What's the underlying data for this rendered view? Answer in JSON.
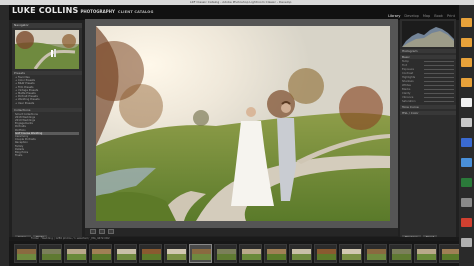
{
  "os": {
    "title_text": "LRF Classic Catalog - Adobe Photoshop Lightroom Classic - Develop"
  },
  "identity": {
    "name": "LUKE COLLINS",
    "studio": "PHOTOGRAPHY",
    "catalog": "CLIENT CATALOG"
  },
  "modules": [
    {
      "label": "Library",
      "active": true
    },
    {
      "label": "Develop",
      "active": false
    },
    {
      "label": "Map",
      "active": false
    },
    {
      "label": "Book",
      "active": false
    },
    {
      "label": "Print",
      "active": false
    }
  ],
  "left": {
    "navigator_label": "Navigator",
    "presets_label": "Presets",
    "collections_label": "Collections",
    "presets": [
      "+ Favorites",
      "+ Color Presets",
      "+ B&W Presets",
      "+ Film Presets",
      "+ Vintage Presets",
      "+ Matte Presets",
      "+ Portrait Presets",
      "+ Wedding Presets",
      "+ User Presets"
    ],
    "collections": [
      "Smart Collections",
      "2018 Weddings",
      "2019 Weddings",
      "Engagements",
      "Portraits",
      "Portfolio",
      "Golf Course Wedding",
      "Ceremony",
      "Couple Portraits",
      "Reception",
      "Family",
      "Details",
      "Blog Picks",
      "Finals"
    ],
    "copy_btn": "Copy...",
    "paste_btn": "Paste"
  },
  "right": {
    "histogram_label": "Histogram",
    "basic_label": "Basic",
    "sliders": [
      "Temp",
      "Tint",
      "Exposure",
      "Contrast",
      "Highlights",
      "Shadows",
      "Whites",
      "Blacks",
      "Clarity",
      "Vibrance",
      "Saturation"
    ],
    "tone_label": "Tone Curve",
    "hsl_label": "HSL / Color",
    "prev_btn": "Previous",
    "reset_btn": "Reset"
  },
  "filmbar": {
    "text": "Folder : Wedding  |  1286 photos / 1 selected / _MG_4472.CR2"
  },
  "colors": {
    "accent": "#e8e8e8",
    "panel": "#2f2f2f",
    "background": "#555555"
  },
  "dock_icons": [
    "folder-icon",
    "folder-icon",
    "folder-icon",
    "folder-icon",
    "document-icon",
    "drive-icon",
    "app-icon",
    "app-icon",
    "app-icon",
    "app-icon",
    "app-icon",
    "trash-icon"
  ]
}
